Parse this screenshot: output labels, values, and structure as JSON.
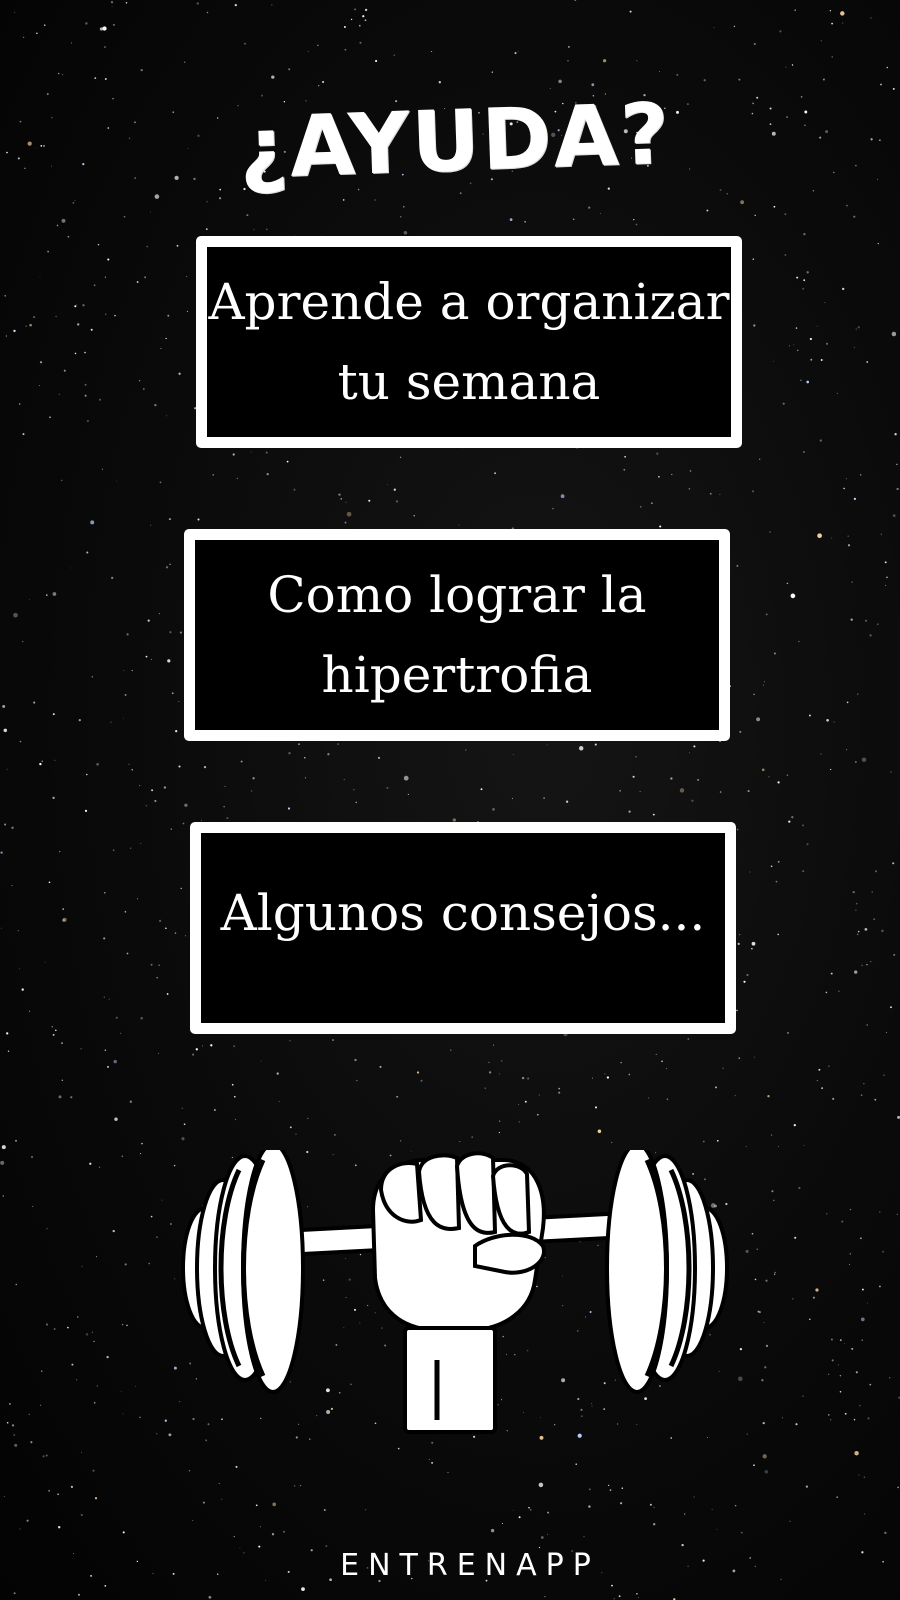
{
  "header": {
    "title": "¿AYUDA?"
  },
  "menu": {
    "items": [
      {
        "lines": [
          "Aprende a organizar",
          "tu semana"
        ]
      },
      {
        "lines": [
          "Como lograr la",
          "hipertrofia"
        ]
      },
      {
        "lines": [
          "Algunos consejos..."
        ]
      }
    ]
  },
  "logo": {
    "icon": "fist-dumbbell-icon"
  },
  "footer": {
    "brand": "ENTRENAPP"
  },
  "colors": {
    "background": "#050505",
    "foreground": "#ffffff",
    "box_fill": "#000000"
  }
}
